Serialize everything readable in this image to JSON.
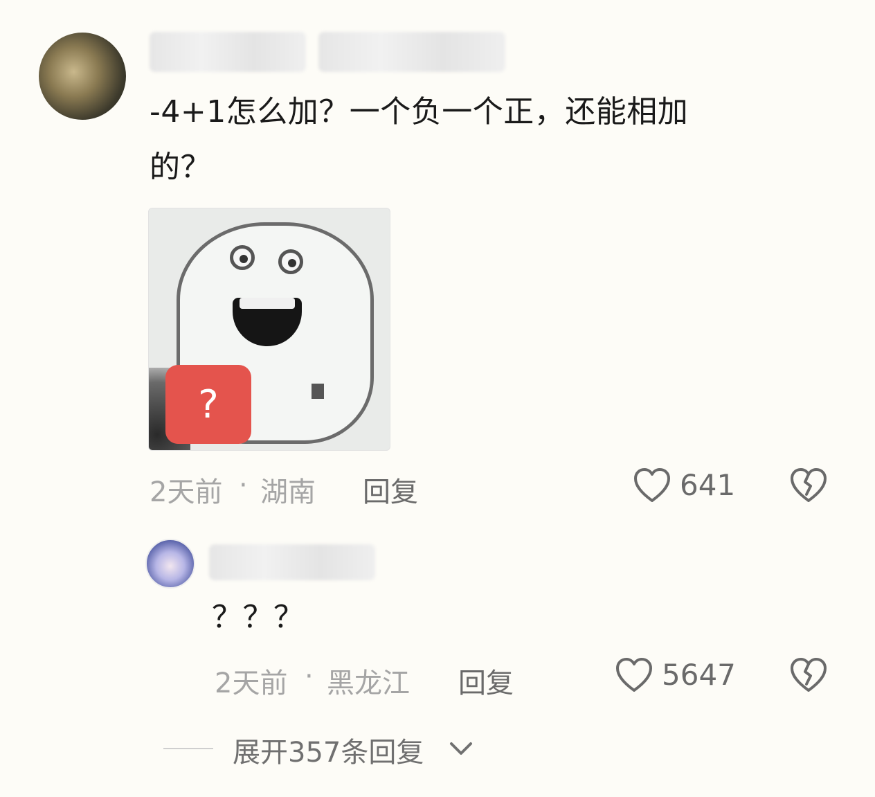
{
  "comment": {
    "text_line1": "-4+1怎么加？一个负一个正，还能相加",
    "text_line2": "的？",
    "sticker_badge": "?",
    "time": "2天前",
    "separator": "·",
    "location": "湖南",
    "reply_label": "回复",
    "like_count": "641",
    "icons": {
      "like": "heart-icon",
      "dislike": "broken-heart-icon"
    }
  },
  "reply": {
    "text": "？？？",
    "time": "2天前",
    "separator": "·",
    "location": "黑龙江",
    "reply_label": "回复",
    "like_count": "5647",
    "icons": {
      "like": "heart-icon",
      "dislike": "broken-heart-icon"
    }
  },
  "expand": {
    "label": "展开357条回复",
    "icon": "chevron-down-icon"
  },
  "colors": {
    "background": "#fdfcf7",
    "badge": "#e4544d",
    "muted_text": "#a5a5a5",
    "action_text": "#6a6a6a"
  }
}
